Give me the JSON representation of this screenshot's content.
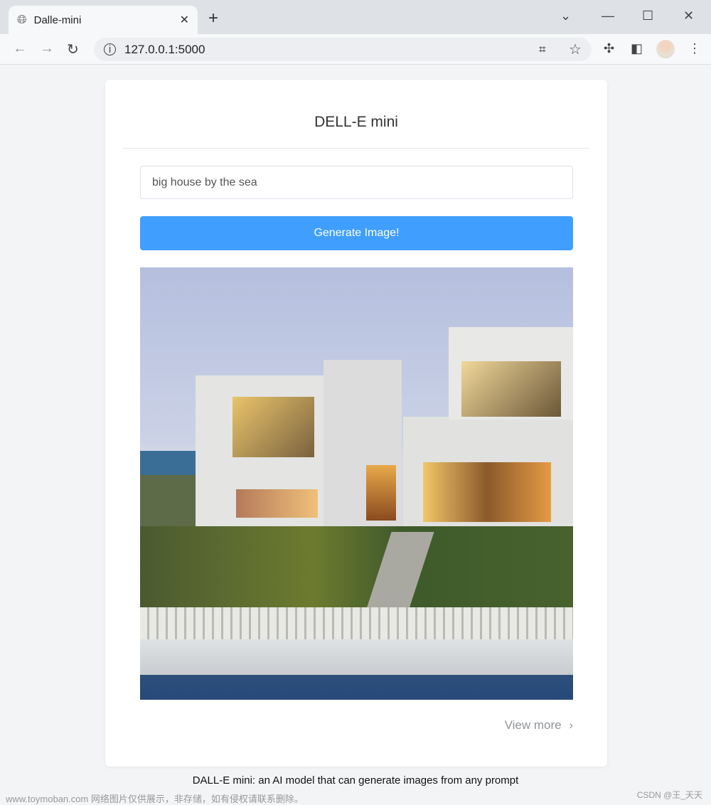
{
  "browser": {
    "tab_title": "Dalle-mini",
    "url": "127.0.0.1:5000"
  },
  "page": {
    "title": "DELL-E mini",
    "prompt_value": "big house by the sea",
    "generate_label": "Generate Image!",
    "image_alt": "Generated image of a big white house by the sea",
    "view_more_label": "View more",
    "caption": "DALL-E mini: an AI model that can generate images from any prompt"
  },
  "watermark": {
    "left": "www.toymoban.com 网络图片仅供展示，非存储，如有侵权请联系删除。",
    "right": "CSDN @王_天天"
  }
}
